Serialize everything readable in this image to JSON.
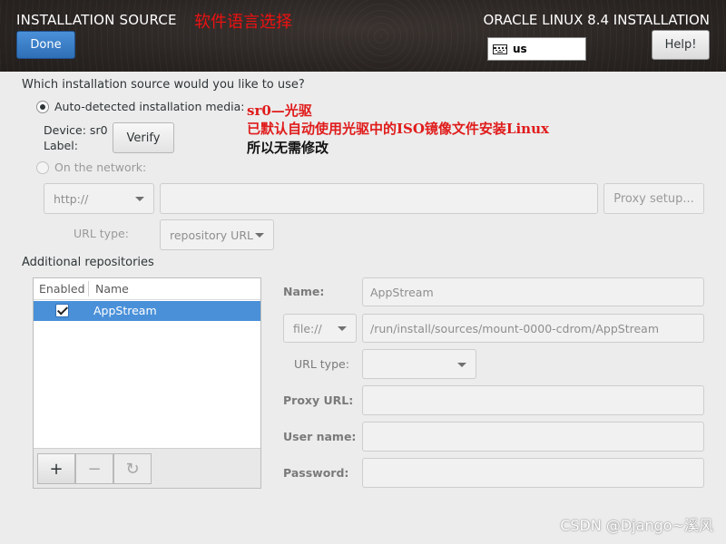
{
  "header": {
    "title": "INSTALLATION SOURCE",
    "annotation": "软件语言选择",
    "done_label": "Done",
    "product": "ORACLE LINUX 8.4 INSTALLATION",
    "keyboard_layout": "us",
    "help_label": "Help!"
  },
  "source": {
    "question": "Which installation source would you like to use?",
    "auto_detected_label": "Auto-detected installation media:",
    "auto_detected_checked": true,
    "device_label": "Device: sr0",
    "label_label": "Label:",
    "verify_label": "Verify",
    "on_network_label": "On the network:",
    "protocol_value": "http://",
    "url_value": "",
    "proxy_button_label": "Proxy setup...",
    "url_type_label": "URL type:",
    "url_type_value": "repository URL"
  },
  "annotations": {
    "line1": "sr0—光驱",
    "line2": "已默认自动使用光驱中的ISO镜像文件安装Linux",
    "line3": "所以无需修改"
  },
  "repos": {
    "heading": "Additional repositories",
    "col_enabled": "Enabled",
    "col_name": "Name",
    "items": [
      {
        "name": "AppStream",
        "enabled": true
      }
    ],
    "add_label": "+",
    "remove_label": "−",
    "refresh_label": "↻"
  },
  "repo_detail": {
    "name_label": "Name:",
    "name_value": "AppStream",
    "protocol_value": "file://",
    "path_value": "/run/install/sources/mount-0000-cdrom/AppStream",
    "url_type_label": "URL type:",
    "url_type_value": "",
    "proxy_url_label": "Proxy URL:",
    "proxy_url_value": "",
    "user_name_label": "User name:",
    "user_name_value": "",
    "password_label": "Password:",
    "password_value": ""
  },
  "watermark": "CSDN @Django~溪风",
  "colors": {
    "accent": "#4a90d9",
    "header_bg": "#2a2523",
    "annotation_red": "#e01b1b"
  }
}
